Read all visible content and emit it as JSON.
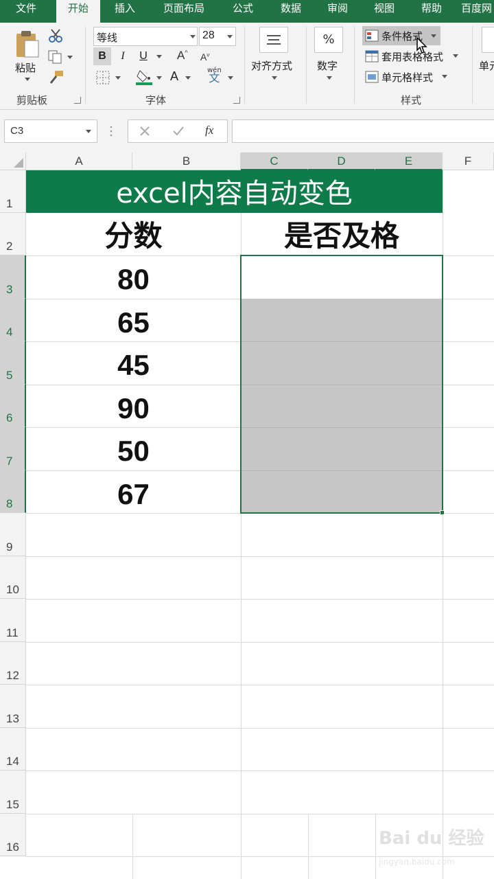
{
  "tabs": [
    "文件",
    "开始",
    "插入",
    "页面布局",
    "公式",
    "数据",
    "审阅",
    "视图",
    "帮助",
    "百度网"
  ],
  "clipboard": {
    "paste": "粘贴",
    "label": "剪贴板"
  },
  "font": {
    "name": "等线",
    "size": "28",
    "label": "字体",
    "bold": "B",
    "italic": "I",
    "underline": "U",
    "wen": "wén",
    "wen_char": "文"
  },
  "alignment": {
    "label": "对齐方式"
  },
  "number": {
    "label": "数字",
    "symbol": "%"
  },
  "styles": {
    "conditional": "条件格式",
    "table": "套用表格格式",
    "cell": "单元格样式",
    "label": "样式"
  },
  "cells_group": {
    "label": "单元"
  },
  "formula_bar": {
    "name_box": "C3",
    "fx": "fx",
    "value": ""
  },
  "columns": [
    "A",
    "B",
    "C",
    "D",
    "E",
    "F"
  ],
  "rows": [
    "1",
    "2",
    "3",
    "4",
    "5",
    "6",
    "7",
    "8",
    "9",
    "10",
    "11",
    "12",
    "13",
    "14",
    "15",
    "16"
  ],
  "sheet": {
    "title": "excel内容自动变色",
    "header_score": "分数",
    "header_pass": "是否及格",
    "scores": [
      "80",
      "65",
      "45",
      "90",
      "50",
      "67"
    ]
  },
  "watermark": {
    "main": "Bai du 经验",
    "sub": "jingyan.baidu.com"
  },
  "colors": {
    "accent": "#217346",
    "title_fill": "#0f7b4a",
    "selection": "#c6c6c6"
  }
}
